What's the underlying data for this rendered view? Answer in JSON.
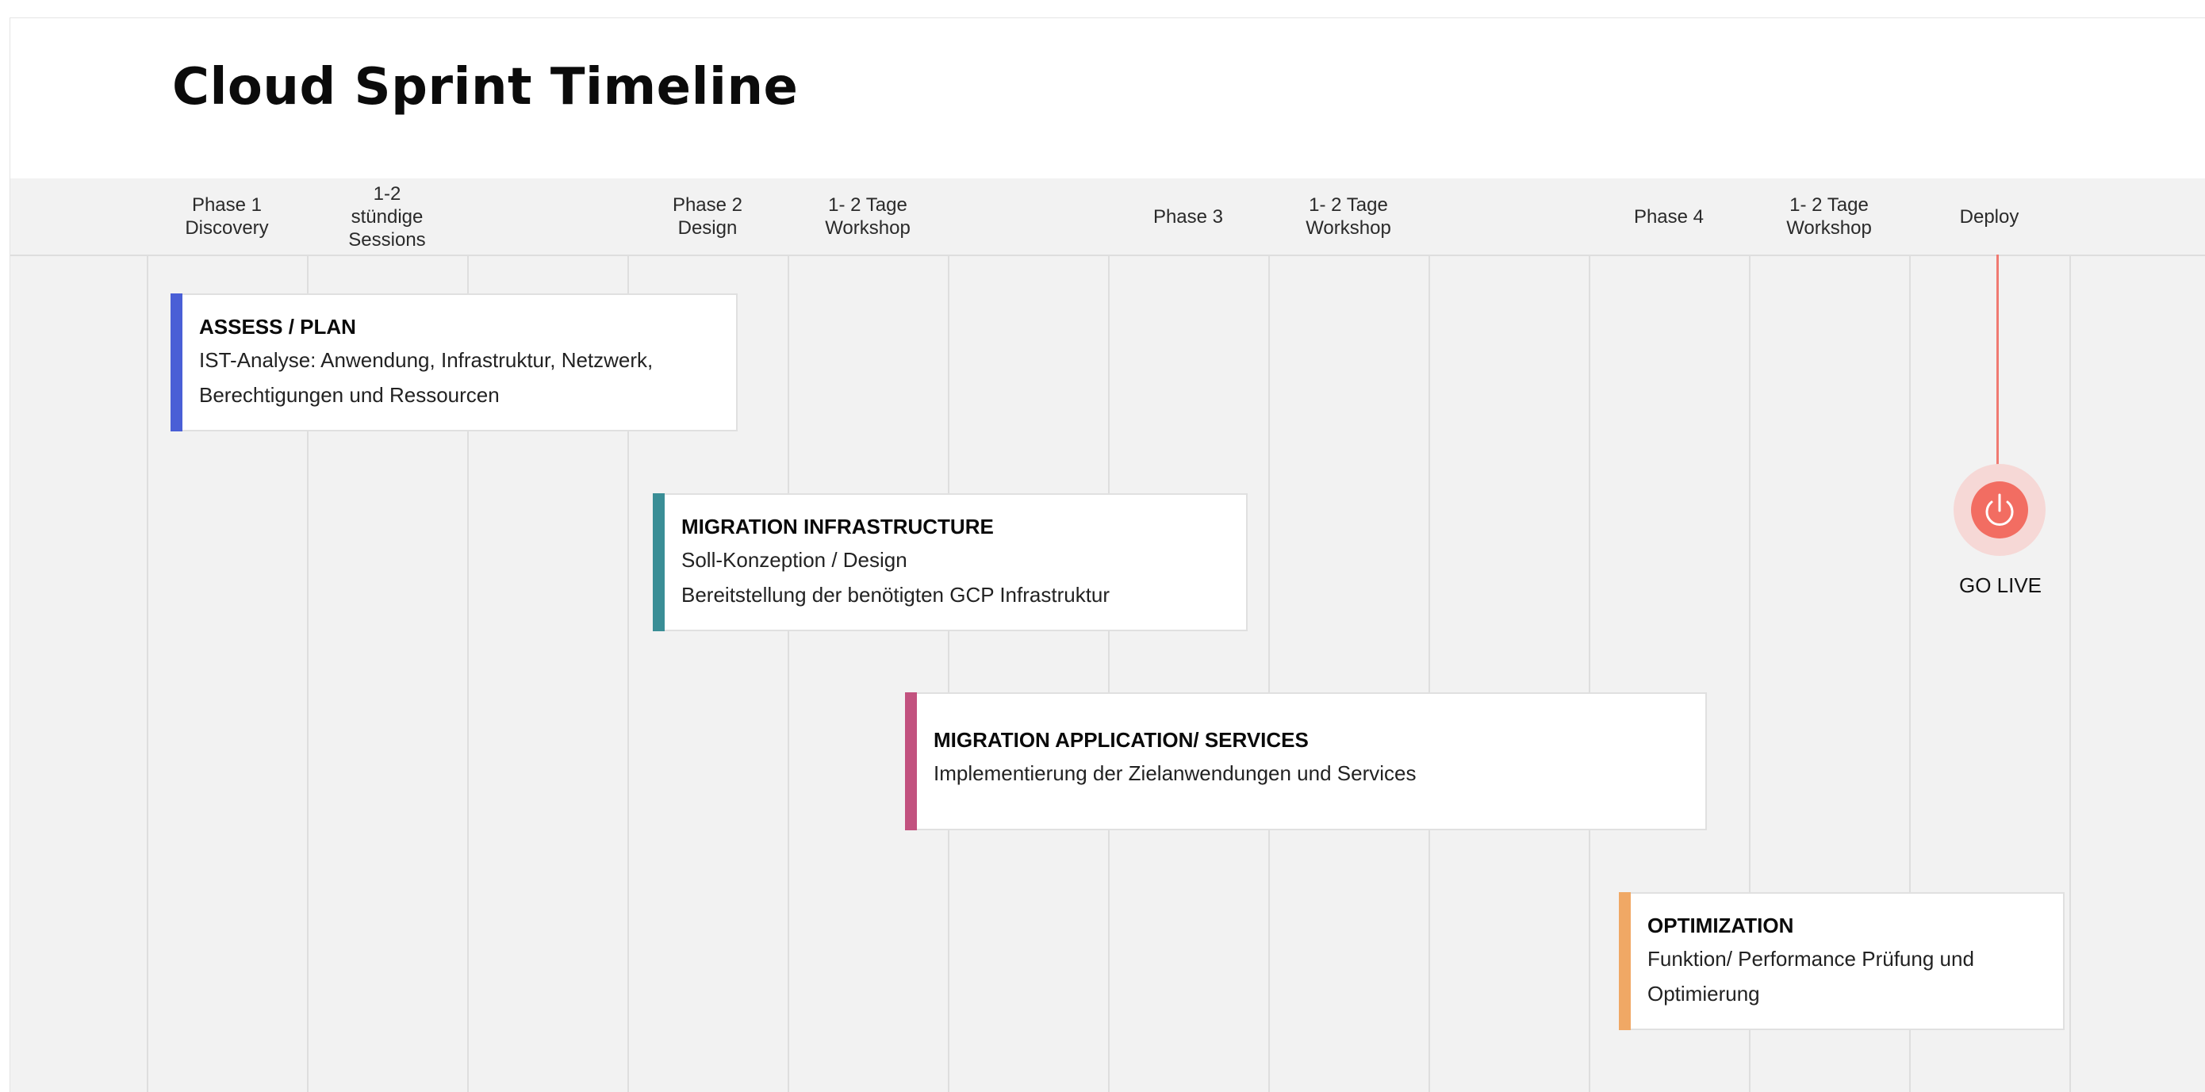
{
  "title": "Cloud Sprint Timeline",
  "columns": [
    "Phase 1\nDiscovery",
    "1-2\nstündige\nSessions",
    "",
    "Phase 2\nDesign",
    "1- 2 Tage\nWorkshop",
    "",
    "Phase 3",
    "1- 2 Tage\nWorkshop",
    "",
    "Phase 4",
    "1- 2 Tage\nWorkshop",
    "Deploy"
  ],
  "cards": [
    {
      "title": "ASSESS / PLAN",
      "lines": [
        "IST-Analyse: Anwendung, Infrastruktur, Netzwerk,",
        "Berechtigungen und Ressourcen"
      ],
      "color": "#4a5fd6"
    },
    {
      "title": "MIGRATION INFRASTRUCTURE",
      "lines": [
        "Soll-Konzeption / Design",
        "Bereitstellung der benötigten GCP Infrastruktur"
      ],
      "color": "#3a8e96"
    },
    {
      "title": "MIGRATION APPLICATION/ SERVICES",
      "lines": [
        "Implementierung der Zielanwendungen und Services"
      ],
      "color": "#c2527f"
    },
    {
      "title": "OPTIMIZATION",
      "lines": [
        "Funktion/ Performance Prüfung und",
        "Optimierung"
      ],
      "color": "#f0a865"
    }
  ],
  "milestone": {
    "label": "GO LIVE",
    "icon": "power-icon",
    "color": "#f26d62"
  }
}
